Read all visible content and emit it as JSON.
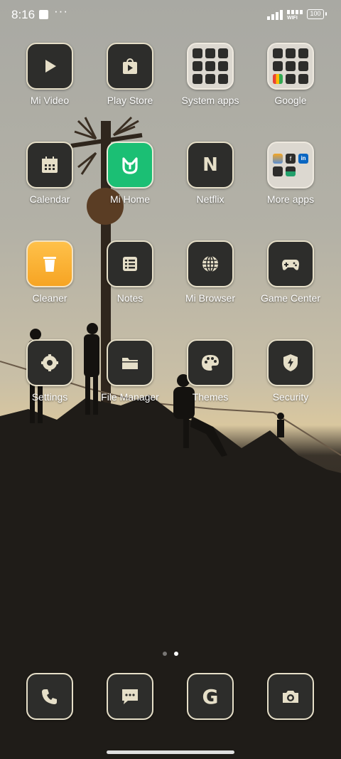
{
  "status_bar": {
    "time": "8:16",
    "more_indicator": "···",
    "wifi_label": "WIFI",
    "battery": "100"
  },
  "apps": [
    {
      "label": "Mi Video",
      "icon": "play-icon"
    },
    {
      "label": "Play Store",
      "icon": "play-store-icon"
    },
    {
      "label": "System apps",
      "icon": "folder-icon"
    },
    {
      "label": "Google",
      "icon": "folder-icon"
    },
    {
      "label": "Calendar",
      "icon": "calendar-icon"
    },
    {
      "label": "Mi Home",
      "icon": "mi-home-icon"
    },
    {
      "label": "Netflix",
      "icon": "netflix-icon"
    },
    {
      "label": "More apps",
      "icon": "folder-icon"
    },
    {
      "label": "Cleaner",
      "icon": "trash-icon"
    },
    {
      "label": "Notes",
      "icon": "notes-icon"
    },
    {
      "label": "Mi Browser",
      "icon": "globe-icon"
    },
    {
      "label": "Game Center",
      "icon": "gamepad-icon"
    },
    {
      "label": "Settings",
      "icon": "gear-icon"
    },
    {
      "label": "File Manager",
      "icon": "file-folder-icon"
    },
    {
      "label": "Themes",
      "icon": "palette-icon"
    },
    {
      "label": "Security",
      "icon": "shield-icon"
    }
  ],
  "netflix_glyph": "N",
  "google_glyph": "G",
  "folder_more_apps": {
    "facebook": "f",
    "linkedin": "in"
  },
  "dock": [
    {
      "name": "phone",
      "icon": "phone-icon"
    },
    {
      "name": "messages",
      "icon": "message-icon"
    },
    {
      "name": "google",
      "icon": "google-icon"
    },
    {
      "name": "camera",
      "icon": "camera-icon"
    }
  ],
  "page_indicator": {
    "pages": 2,
    "current": 2
  },
  "colors": {
    "icon_bg": "#2d2d2b",
    "icon_border": "#e6dfc8",
    "mi_home": "#1bbf74",
    "cleaner": "#f6a423"
  }
}
